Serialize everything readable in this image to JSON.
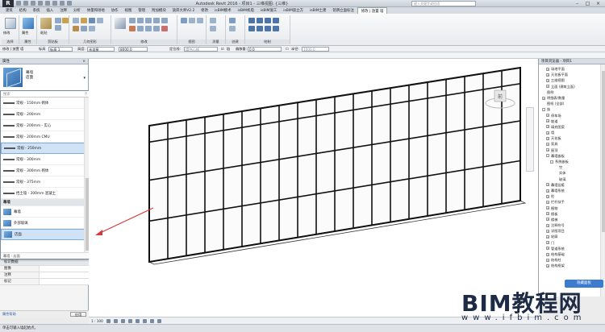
{
  "titlebar": {
    "logo": "R",
    "title": "Autodesk Revit 2016 -    项目1 - 三维视图: {三维}",
    "search_placeholder": "键入关键字或短语",
    "win_min": "–",
    "win_max": "□",
    "win_close": "×"
  },
  "ribbon_tabs": [
    "建筑",
    "结构",
    "系统",
    "插入",
    "注释",
    "分析",
    "体量和场地",
    "协作",
    "视图",
    "管理",
    "附加模块",
    "族库大师V2.2",
    "修改",
    "isBIM模术",
    "isBIM机电",
    "isBIM施工",
    "isBIM族立方",
    "isBIM土建",
    "铭牌立面标注",
    "修改 | 放置 墙"
  ],
  "active_tab_index": 19,
  "ribbon_groups": [
    "选择",
    "属性",
    "剪贴板",
    "几何图形",
    "修改",
    "视图",
    "测量",
    "创建",
    "绘制"
  ],
  "ribbon_buttons": {
    "modify": "修改",
    "properties": "属性",
    "paste": "粘贴"
  },
  "optbar": {
    "height_label": "高度:",
    "height_value": "未连接",
    "height_num": "8000.0",
    "location_label": "定位线:",
    "location_value": "墙中心线",
    "chain_label": "链",
    "offset_label": "偏移量:",
    "offset_value": "0.0",
    "radius_label": "半径:",
    "radius_value": "1000.0",
    "level_label": "标高",
    "level_value": "标高 1"
  },
  "properties": {
    "header": "属性",
    "close": "×",
    "type_family": "幕墙",
    "type_name": "店面",
    "dd_arrow": "▾",
    "search_placeholder": "搜索",
    "search_icon": "magnifier",
    "items": [
      {
        "label": "常规 - 150mm 砌体",
        "kind": "wall"
      },
      {
        "label": "常规 - 200mm",
        "kind": "wall"
      },
      {
        "label": "常规 - 200mm - 实心",
        "kind": "wall"
      },
      {
        "label": "常规 - 200mm CMU",
        "kind": "wall"
      },
      {
        "label": "常规 - 250mm",
        "kind": "wall",
        "selected": true
      },
      {
        "label": "常规 - 300mm",
        "kind": "wall"
      },
      {
        "label": "常规 - 300mm 砌体",
        "kind": "wall"
      },
      {
        "label": "常规 - 375mm",
        "kind": "wall"
      },
      {
        "label": "挡土墙 - 300mm 混凝土",
        "kind": "wall"
      },
      {
        "label": "幕墙",
        "kind": "category"
      },
      {
        "label": "幕墙",
        "kind": "curtain"
      },
      {
        "label": "外部玻璃",
        "kind": "curtain"
      },
      {
        "label": "店面",
        "kind": "curtain",
        "selected": true
      }
    ],
    "recent_footer": "最近使用的类型",
    "current_label": "幕墙 : 店面",
    "section_title": "标识数据",
    "rows": [
      {
        "key": "图像",
        "value": ""
      },
      {
        "key": "注释",
        "value": ""
      },
      {
        "key": "标记",
        "value": ""
      }
    ],
    "help_link": "属性帮助",
    "apply": "应用"
  },
  "viewport": {
    "viewcube_label": "前",
    "scale": "1 : 100"
  },
  "browser": {
    "header": "项目浏览器 - 项目1",
    "tree": [
      {
        "label": "场地平面",
        "indent": 1,
        "box": "+"
      },
      {
        "label": "天花板平面",
        "indent": 1,
        "box": "+"
      },
      {
        "label": "三维视图",
        "indent": 1,
        "box": "+"
      },
      {
        "label": "立面 (建筑立面)",
        "indent": 1,
        "box": "+"
      },
      {
        "label": "图例",
        "indent": 0,
        "box": ""
      },
      {
        "label": "明细表/数量",
        "indent": 0,
        "box": "+"
      },
      {
        "label": "图纸 (全部)",
        "indent": 0,
        "box": ""
      },
      {
        "label": "族",
        "indent": 0,
        "box": "-"
      },
      {
        "label": "停车场",
        "indent": 1,
        "box": "+"
      },
      {
        "label": "坡道",
        "indent": 1,
        "box": "+"
      },
      {
        "label": "填充图案",
        "indent": 1,
        "box": "+"
      },
      {
        "label": "墙",
        "indent": 1,
        "box": "+"
      },
      {
        "label": "天花板",
        "indent": 1,
        "box": "+"
      },
      {
        "label": "家具",
        "indent": 1,
        "box": "+"
      },
      {
        "label": "屋顶",
        "indent": 1,
        "box": "+"
      },
      {
        "label": "幕墙嵌板",
        "indent": 1,
        "box": "-"
      },
      {
        "label": "系统嵌板",
        "indent": 2,
        "box": "-"
      },
      {
        "label": "空",
        "indent": 3,
        "box": ""
      },
      {
        "label": "实体",
        "indent": 3,
        "box": ""
      },
      {
        "label": "玻璃",
        "indent": 3,
        "box": ""
      },
      {
        "label": "幕墙竖梃",
        "indent": 1,
        "box": "+"
      },
      {
        "label": "幕墙系统",
        "indent": 1,
        "box": "+"
      },
      {
        "label": "柱",
        "indent": 1,
        "box": "+"
      },
      {
        "label": "栏杆扶手",
        "indent": 1,
        "box": "+"
      },
      {
        "label": "植物",
        "indent": 1,
        "box": "+"
      },
      {
        "label": "楼板",
        "indent": 1,
        "box": "+"
      },
      {
        "label": "楼梯",
        "indent": 1,
        "box": "+"
      },
      {
        "label": "注释符号",
        "indent": 1,
        "box": "+"
      },
      {
        "label": "详图项目",
        "indent": 1,
        "box": "+"
      },
      {
        "label": "轮廓",
        "indent": 1,
        "box": "+"
      },
      {
        "label": "门",
        "indent": 1,
        "box": "+"
      },
      {
        "label": "管道系统",
        "indent": 1,
        "box": "+"
      },
      {
        "label": "结构基础",
        "indent": 1,
        "box": "+"
      },
      {
        "label": "结构柱",
        "indent": 1,
        "box": "+"
      },
      {
        "label": "结构框架",
        "indent": 1,
        "box": "+"
      }
    ]
  },
  "status_text": "单击可输入墙起始点。",
  "float_badge": "隐藏面板",
  "watermark": {
    "main": "BIM教程网",
    "sub": "www.ifbim.com"
  },
  "colors": {
    "accent": "#3a74b5",
    "selection": "#cfe2f6",
    "arrow": "#d63a3a"
  }
}
